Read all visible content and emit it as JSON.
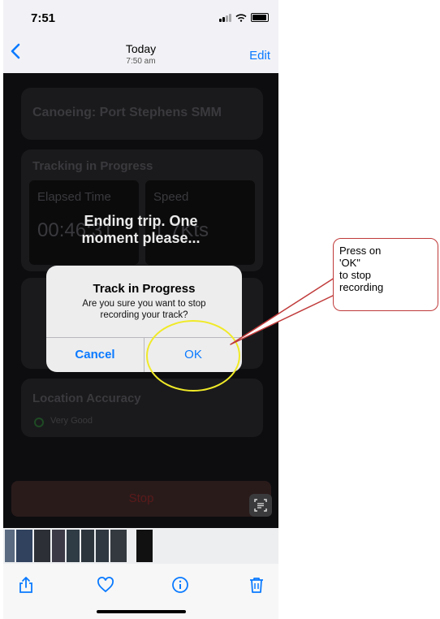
{
  "status_bar": {
    "time": "7:51"
  },
  "nav": {
    "title": "Today",
    "subtitle": "7:50 am",
    "edit_label": "Edit"
  },
  "trip": {
    "title": "Canoeing: Port Stephens SMM"
  },
  "tracking": {
    "section_title": "Tracking in Progress",
    "elapsed_label": "Elapsed Time",
    "elapsed_value": "00:46:31",
    "speed_label": "Speed",
    "speed_value": "1.7Kts"
  },
  "location": {
    "section_title": "Location Accuracy",
    "value": "Very Good"
  },
  "overlay": {
    "line1": "Ending trip. One",
    "line2": "moment please..."
  },
  "alert": {
    "title": "Track in Progress",
    "message": "Are you sure you want to stop recording your track?",
    "cancel_label": "Cancel",
    "ok_label": "OK"
  },
  "stop_button": {
    "label": "Stop"
  },
  "annotation": {
    "text": "Press on\n'OK\"\nto stop\nrecording"
  },
  "colors": {
    "accent": "#0a7aff",
    "highlight": "#f0ea28",
    "callout_border": "#c03a3a"
  },
  "toolbar_icons": [
    "share-icon",
    "heart-icon",
    "info-icon",
    "trash-icon"
  ]
}
